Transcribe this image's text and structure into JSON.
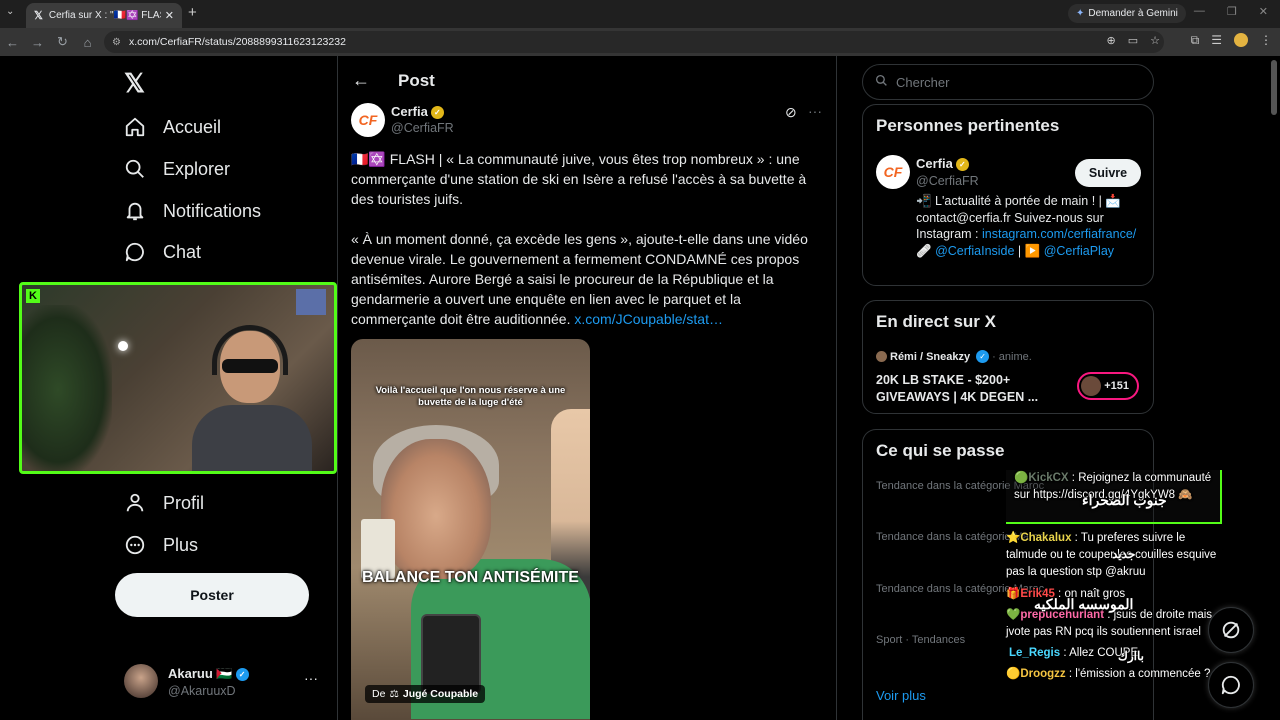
{
  "browser": {
    "tab_title": "Cerfia sur X : \"🇫🇷✡️ FLASH | « La",
    "url": "x.com/CerfiaFR/status/2088899311623123232",
    "gemini_label": "Demander à Gemini"
  },
  "nav": {
    "items": [
      {
        "label": "Accueil",
        "icon": "home-icon"
      },
      {
        "label": "Explorer",
        "icon": "search-icon"
      },
      {
        "label": "Notifications",
        "icon": "bell-icon"
      },
      {
        "label": "Chat",
        "icon": "chat-icon"
      },
      {
        "label": "Profil",
        "icon": "person-icon"
      },
      {
        "label": "Plus",
        "icon": "more-circle-icon"
      }
    ],
    "post_button": "Poster",
    "account": {
      "name": "Akaruu 🇵🇸",
      "handle": "@AkaruuxD",
      "more": "···"
    }
  },
  "post": {
    "header_title": "Post",
    "author_name": "Cerfia",
    "author_handle": "@CerfiaFR",
    "author_initials": "CF",
    "paragraph1": "🇫🇷✡️ FLASH | « La communauté juive, vous êtes trop nombreux » : une commerçante d'une station de ski en Isère a refusé l'accès à sa buvette à des touristes juifs.",
    "paragraph2": "« À un moment donné, ça excède les gens », ajoute-t-elle dans une vidéo devenue virale. Le gouvernement a fermement CONDAMNÉ ces propos antisémites. Aurore Bergé a saisi le procureur de la République et la gendarmerie a ouvert une enquête en lien avec le parquet et la commerçante doit être auditionnée.",
    "link": "x.com/JCoupable/stat…",
    "image": {
      "top_caption": "Voilà l'accueil que l'on nous réserve à une buvette de la luge d'été",
      "overlay_text": "BALANCE TON ANTISÉMITE",
      "credit_prefix": "De",
      "credit_source": "Jugé Coupable"
    }
  },
  "sidebar": {
    "search_placeholder": "Chercher",
    "relevant": {
      "title": "Personnes pertinentes",
      "name": "Cerfia",
      "handle": "@CerfiaFR",
      "initials": "CF",
      "follow": "Suivre",
      "bio_text": "📲 L'actualité à portée de main ! | 📩 contact@cerfia.fr Suivez-nous sur Instagram :",
      "bio_link1": "instagram.com/cerfiafrance/",
      "bio_mid": " 🩹",
      "bio_link2": "@CerfiaInside",
      "bio_sep": " | ▶️ ",
      "bio_link3": "@CerfiaPlay"
    },
    "live": {
      "title": "En direct sur X",
      "host": "Rémi / Sneakzy",
      "category": "anime.",
      "stream_title": "20K LB STAKE - $200+ GIVEAWAYS | 4K DEGEN ...",
      "count": "+151"
    },
    "trends": {
      "title": "Ce qui se passe",
      "meta": [
        "Tendance dans la catégorie Maroc",
        "Tendance dans la catégorie Maroc",
        "Tendance dans la catégorie Maroc",
        "Sport · Tendances"
      ],
      "see_more": "Voir plus"
    }
  },
  "chat": {
    "pinned": {
      "user": "KickCX",
      "text": " : Rejoignez la communauté sur https://discord.gg/4YgkYW8 🙈"
    },
    "messages": [
      {
        "user": "Chakalux",
        "text": " : Tu preferes suivre le talmude ou te couper les couilles esquive pas la question stp @akruu"
      },
      {
        "user": "Erik45",
        "text": " : on naît gros"
      },
      {
        "user": "prepucehurlant",
        "text": " : jsuis de droite mais jvote pas RN pcq ils soutiennent israel"
      },
      {
        "user": "Le_Regis",
        "text": " : Allez COUPE"
      },
      {
        "user": "Droogzz",
        "text": " : l'émission a commencée ?"
      }
    ],
    "arabic": [
      "جنوب الصحراء",
      "جدید",
      "الموسسه الملكيه",
      "باارك"
    ]
  }
}
